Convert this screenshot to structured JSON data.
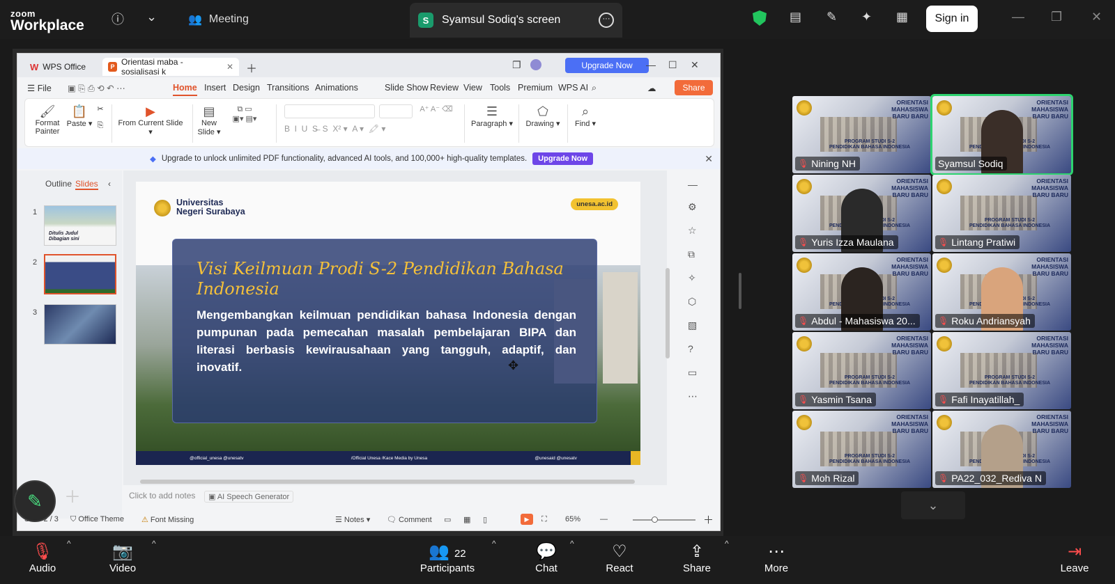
{
  "zoom": {
    "logo_small": "zoom",
    "logo_big": "Workplace",
    "meeting_label": "Meeting",
    "screen_tab": "Syamsul Sodiq's screen",
    "screen_badge": "S",
    "sign_in": "Sign in"
  },
  "wps": {
    "tab_home": "WPS Office",
    "tab_doc": "Orientasi maba - sosialisasi k",
    "upgrade_now": "Upgrade Now",
    "file_menu": "File",
    "menu": [
      "Home",
      "Insert",
      "Design",
      "Transitions",
      "Animations",
      "Slide Show",
      "Review",
      "View",
      "Tools",
      "Premium",
      "WPS AI"
    ],
    "share": "Share",
    "ribbon": {
      "format_painter": "Format Painter",
      "paste": "Paste",
      "from_current_slide": "From Current Slide",
      "new_slide": "New Slide",
      "paragraph": "Paragraph",
      "drawing": "Drawing",
      "find": "Find"
    },
    "notice": "Upgrade to unlock unlimited PDF functionality, advanced AI tools, and 100,000+ high-quality templates.",
    "notice_btn": "Upgrade Now",
    "outline": "Outline",
    "slides": "Slides",
    "thumb_numbers": [
      "1",
      "2",
      "3"
    ],
    "thumb1_text": "Ditulis Judul Dibagian sini",
    "notes_placeholder": "Click to add notes",
    "ai_speech": "AI Speech Generator",
    "status": {
      "slide": "Slide 2 / 3",
      "theme": "Office Theme",
      "font_missing": "Font Missing",
      "notes": "Notes",
      "comment": "Comment",
      "zoom": "65%"
    },
    "zoom_fraction": 0.55
  },
  "slide": {
    "uni_name_1": "Universitas",
    "uni_name_2": "Negeri Surabaya",
    "site": "unesa.ac.id",
    "title": "Visi Keilmuan Prodi S-2 Pendidikan Bahasa Indonesia",
    "body": "Mengembangkan keilmuan pendidikan bahasa Indonesia dengan pumpunan pada pemecahan masalah pembelajaran BIPA dan literasi berbasis kewirausahaan yang tangguh, adaptif, dan inovatif.",
    "footer": [
      "@official_unesa @unesatv",
      "/Official Unesa /Kace Media by Unesa",
      "@unesaid @unesatv"
    ]
  },
  "tile_text": {
    "orientasi": [
      "ORIENTASI",
      "MAHASISWA",
      "BARU BARU"
    ],
    "program": [
      "PROGRAM STUDI S-2",
      "PENDIDIKAN BAHASA INDONESIA"
    ]
  },
  "participants": [
    {
      "name": "Nining NH",
      "muted": true
    },
    {
      "name": "Syamsul Sodiq",
      "muted": false,
      "speaking": true
    },
    {
      "name": "Yuris Izza Maulana",
      "muted": true
    },
    {
      "name": "Lintang Pratiwi",
      "muted": true
    },
    {
      "name": "Abdul - Mahasiswa 20...",
      "muted": true
    },
    {
      "name": "Roku Andriansyah",
      "muted": true
    },
    {
      "name": "Yasmin Tsana",
      "muted": true
    },
    {
      "name": "Fafi Inayatillah_",
      "muted": true
    },
    {
      "name": "Moh Rizal",
      "muted": true
    },
    {
      "name": "PA22_032_Rediva N",
      "muted": true
    }
  ],
  "controls": {
    "audio": "Audio",
    "video": "Video",
    "participants": "Participants",
    "participants_count": "22",
    "chat": "Chat",
    "react": "React",
    "share": "Share",
    "more": "More",
    "leave": "Leave"
  }
}
